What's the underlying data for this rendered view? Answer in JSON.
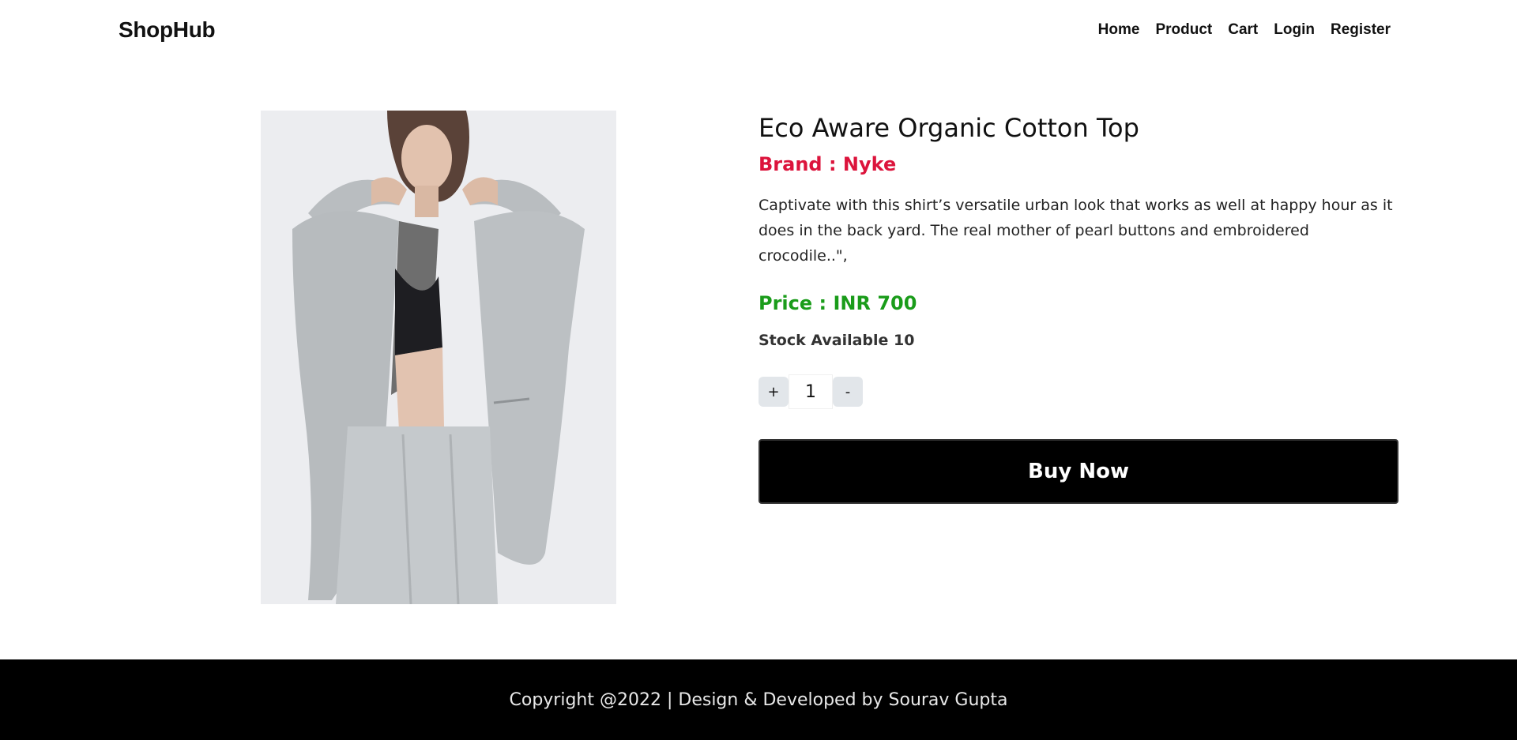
{
  "header": {
    "brand": "ShopHub",
    "nav": [
      "Home",
      "Product",
      "Cart",
      "Login",
      "Register"
    ]
  },
  "product": {
    "image_icon": "product-photo",
    "title": "Eco Aware Organic Cotton Top",
    "brand_label": "Brand : Nyke",
    "description": "Captivate with this shirt’s versatile urban look that works as well at happy hour as it does in the back yard. The real mother of pearl buttons and embroidered crocodile..\",",
    "price_label": "Price : INR 700",
    "stock_label": "Stock Available 10",
    "quantity": {
      "increment_label": "+",
      "value": "1",
      "decrement_label": "-"
    },
    "buy_label": "Buy Now"
  },
  "footer": {
    "text": "Copyright @2022 | Design & Developed by Sourav Gupta"
  },
  "colors": {
    "brand_accent": "#dc143c",
    "price_accent": "#1a9c1a",
    "buy_button": "#000000",
    "footer_bg": "#000000"
  }
}
